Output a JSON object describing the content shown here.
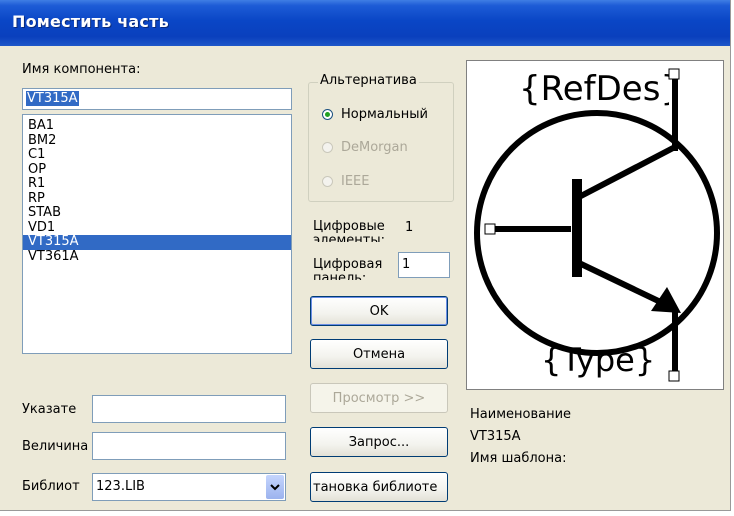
{
  "window": {
    "title": "Поместить часть"
  },
  "component": {
    "label": "Имя компонента:",
    "value": "VT315A",
    "list": [
      "BA1",
      "BM2",
      "C1",
      "OP",
      "R1",
      "RP",
      "STAB",
      "VD1",
      "VT315A",
      "VT361A"
    ],
    "selected": "VT315A"
  },
  "alternative": {
    "legend": "Альтернатива",
    "options": [
      {
        "label": "Нормальный",
        "checked": true,
        "enabled": true
      },
      {
        "label": "DeMorgan",
        "checked": false,
        "enabled": false
      },
      {
        "label": "IEEE",
        "checked": false,
        "enabled": false
      }
    ]
  },
  "digital": {
    "elements_label": "Цифровые",
    "elements_label_line2": "элементы:",
    "elements_value": "1",
    "panel_label": "Цифровая",
    "panel_label_line2": "панель:",
    "panel_value": "1"
  },
  "buttons": {
    "ok": "OK",
    "cancel": "Отмена",
    "preview": "Просмотр >>",
    "query": "Запрос...",
    "library_setup": "тановка библиоте"
  },
  "fields": {
    "pointer_label": "Указате",
    "pointer_value": "",
    "value_label": "Величина",
    "value_value": "",
    "library_label": "Библиот",
    "library_value": "123.LIB"
  },
  "symbol": {
    "refdes": "{RefDes}",
    "type": "{Type}"
  },
  "info": {
    "name_label": "Наименование",
    "name_value": "VT315A",
    "template_label": "Имя шаблона:"
  },
  "colors": {
    "title_bar": "#0a46c6",
    "selection": "#316ac5",
    "dialog_bg": "#ece9d8"
  },
  "icons": {
    "combo_arrow": "chevron-down-icon"
  }
}
